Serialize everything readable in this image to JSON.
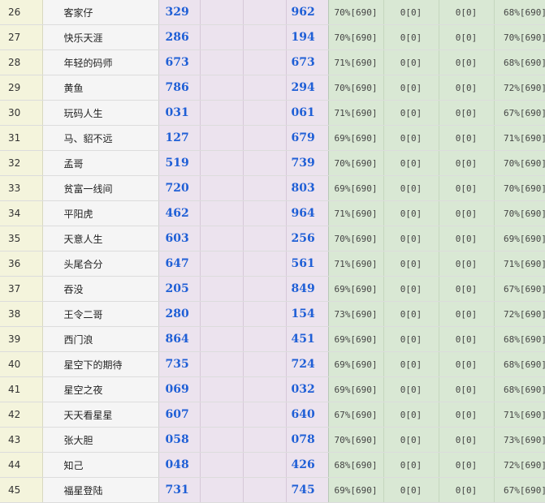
{
  "table": {
    "rows": [
      {
        "rank": "26",
        "name": "客家仔",
        "n1": "329",
        "n2": "962",
        "p1": "70%[690]",
        "p2": "0[0]",
        "p3": "0[0]",
        "p4": "68%[690]"
      },
      {
        "rank": "27",
        "name": "快乐天涯",
        "n1": "286",
        "n2": "194",
        "p1": "70%[690]",
        "p2": "0[0]",
        "p3": "0[0]",
        "p4": "70%[690]"
      },
      {
        "rank": "28",
        "name": "年轻的码师",
        "n1": "673",
        "n2": "673",
        "p1": "71%[690]",
        "p2": "0[0]",
        "p3": "0[0]",
        "p4": "68%[690]"
      },
      {
        "rank": "29",
        "name": "黄鱼",
        "n1": "786",
        "n2": "294",
        "p1": "70%[690]",
        "p2": "0[0]",
        "p3": "0[0]",
        "p4": "72%[690]"
      },
      {
        "rank": "30",
        "name": "玩码人生",
        "n1": "031",
        "n2": "061",
        "p1": "71%[690]",
        "p2": "0[0]",
        "p3": "0[0]",
        "p4": "67%[690]"
      },
      {
        "rank": "31",
        "name": "马、貂不远",
        "n1": "127",
        "n2": "679",
        "p1": "69%[690]",
        "p2": "0[0]",
        "p3": "0[0]",
        "p4": "71%[690]"
      },
      {
        "rank": "32",
        "name": "孟哥",
        "n1": "519",
        "n2": "739",
        "p1": "70%[690]",
        "p2": "0[0]",
        "p3": "0[0]",
        "p4": "70%[690]"
      },
      {
        "rank": "33",
        "name": "贫富一线间",
        "n1": "720",
        "n2": "803",
        "p1": "69%[690]",
        "p2": "0[0]",
        "p3": "0[0]",
        "p4": "70%[690]"
      },
      {
        "rank": "34",
        "name": "平阳虎",
        "n1": "462",
        "n2": "964",
        "p1": "71%[690]",
        "p2": "0[0]",
        "p3": "0[0]",
        "p4": "70%[690]"
      },
      {
        "rank": "35",
        "name": "天意人生",
        "n1": "603",
        "n2": "256",
        "p1": "70%[690]",
        "p2": "0[0]",
        "p3": "0[0]",
        "p4": "69%[690]"
      },
      {
        "rank": "36",
        "name": "头尾合分",
        "n1": "647",
        "n2": "561",
        "p1": "71%[690]",
        "p2": "0[0]",
        "p3": "0[0]",
        "p4": "71%[690]"
      },
      {
        "rank": "37",
        "name": "吞没",
        "n1": "205",
        "n2": "849",
        "p1": "69%[690]",
        "p2": "0[0]",
        "p3": "0[0]",
        "p4": "67%[690]"
      },
      {
        "rank": "38",
        "name": "王令二哥",
        "n1": "280",
        "n2": "154",
        "p1": "73%[690]",
        "p2": "0[0]",
        "p3": "0[0]",
        "p4": "72%[690]"
      },
      {
        "rank": "39",
        "name": "西门浪",
        "n1": "864",
        "n2": "451",
        "p1": "69%[690]",
        "p2": "0[0]",
        "p3": "0[0]",
        "p4": "68%[690]"
      },
      {
        "rank": "40",
        "name": "星空下的期待",
        "n1": "735",
        "n2": "724",
        "p1": "69%[690]",
        "p2": "0[0]",
        "p3": "0[0]",
        "p4": "68%[690]"
      },
      {
        "rank": "41",
        "name": "星空之夜",
        "n1": "069",
        "n2": "032",
        "p1": "69%[690]",
        "p2": "0[0]",
        "p3": "0[0]",
        "p4": "68%[690]"
      },
      {
        "rank": "42",
        "name": "天天看星星",
        "n1": "607",
        "n2": "640",
        "p1": "67%[690]",
        "p2": "0[0]",
        "p3": "0[0]",
        "p4": "71%[690]"
      },
      {
        "rank": "43",
        "name": "张大胆",
        "n1": "058",
        "n2": "078",
        "p1": "70%[690]",
        "p2": "0[0]",
        "p3": "0[0]",
        "p4": "73%[690]"
      },
      {
        "rank": "44",
        "name": "知己",
        "n1": "048",
        "n2": "426",
        "p1": "68%[690]",
        "p2": "0[0]",
        "p3": "0[0]",
        "p4": "72%[690]"
      },
      {
        "rank": "45",
        "name": "福星登陆",
        "n1": "731",
        "n2": "745",
        "p1": "69%[690]",
        "p2": "0[0]",
        "p3": "0[0]",
        "p4": "67%[690]"
      }
    ]
  }
}
